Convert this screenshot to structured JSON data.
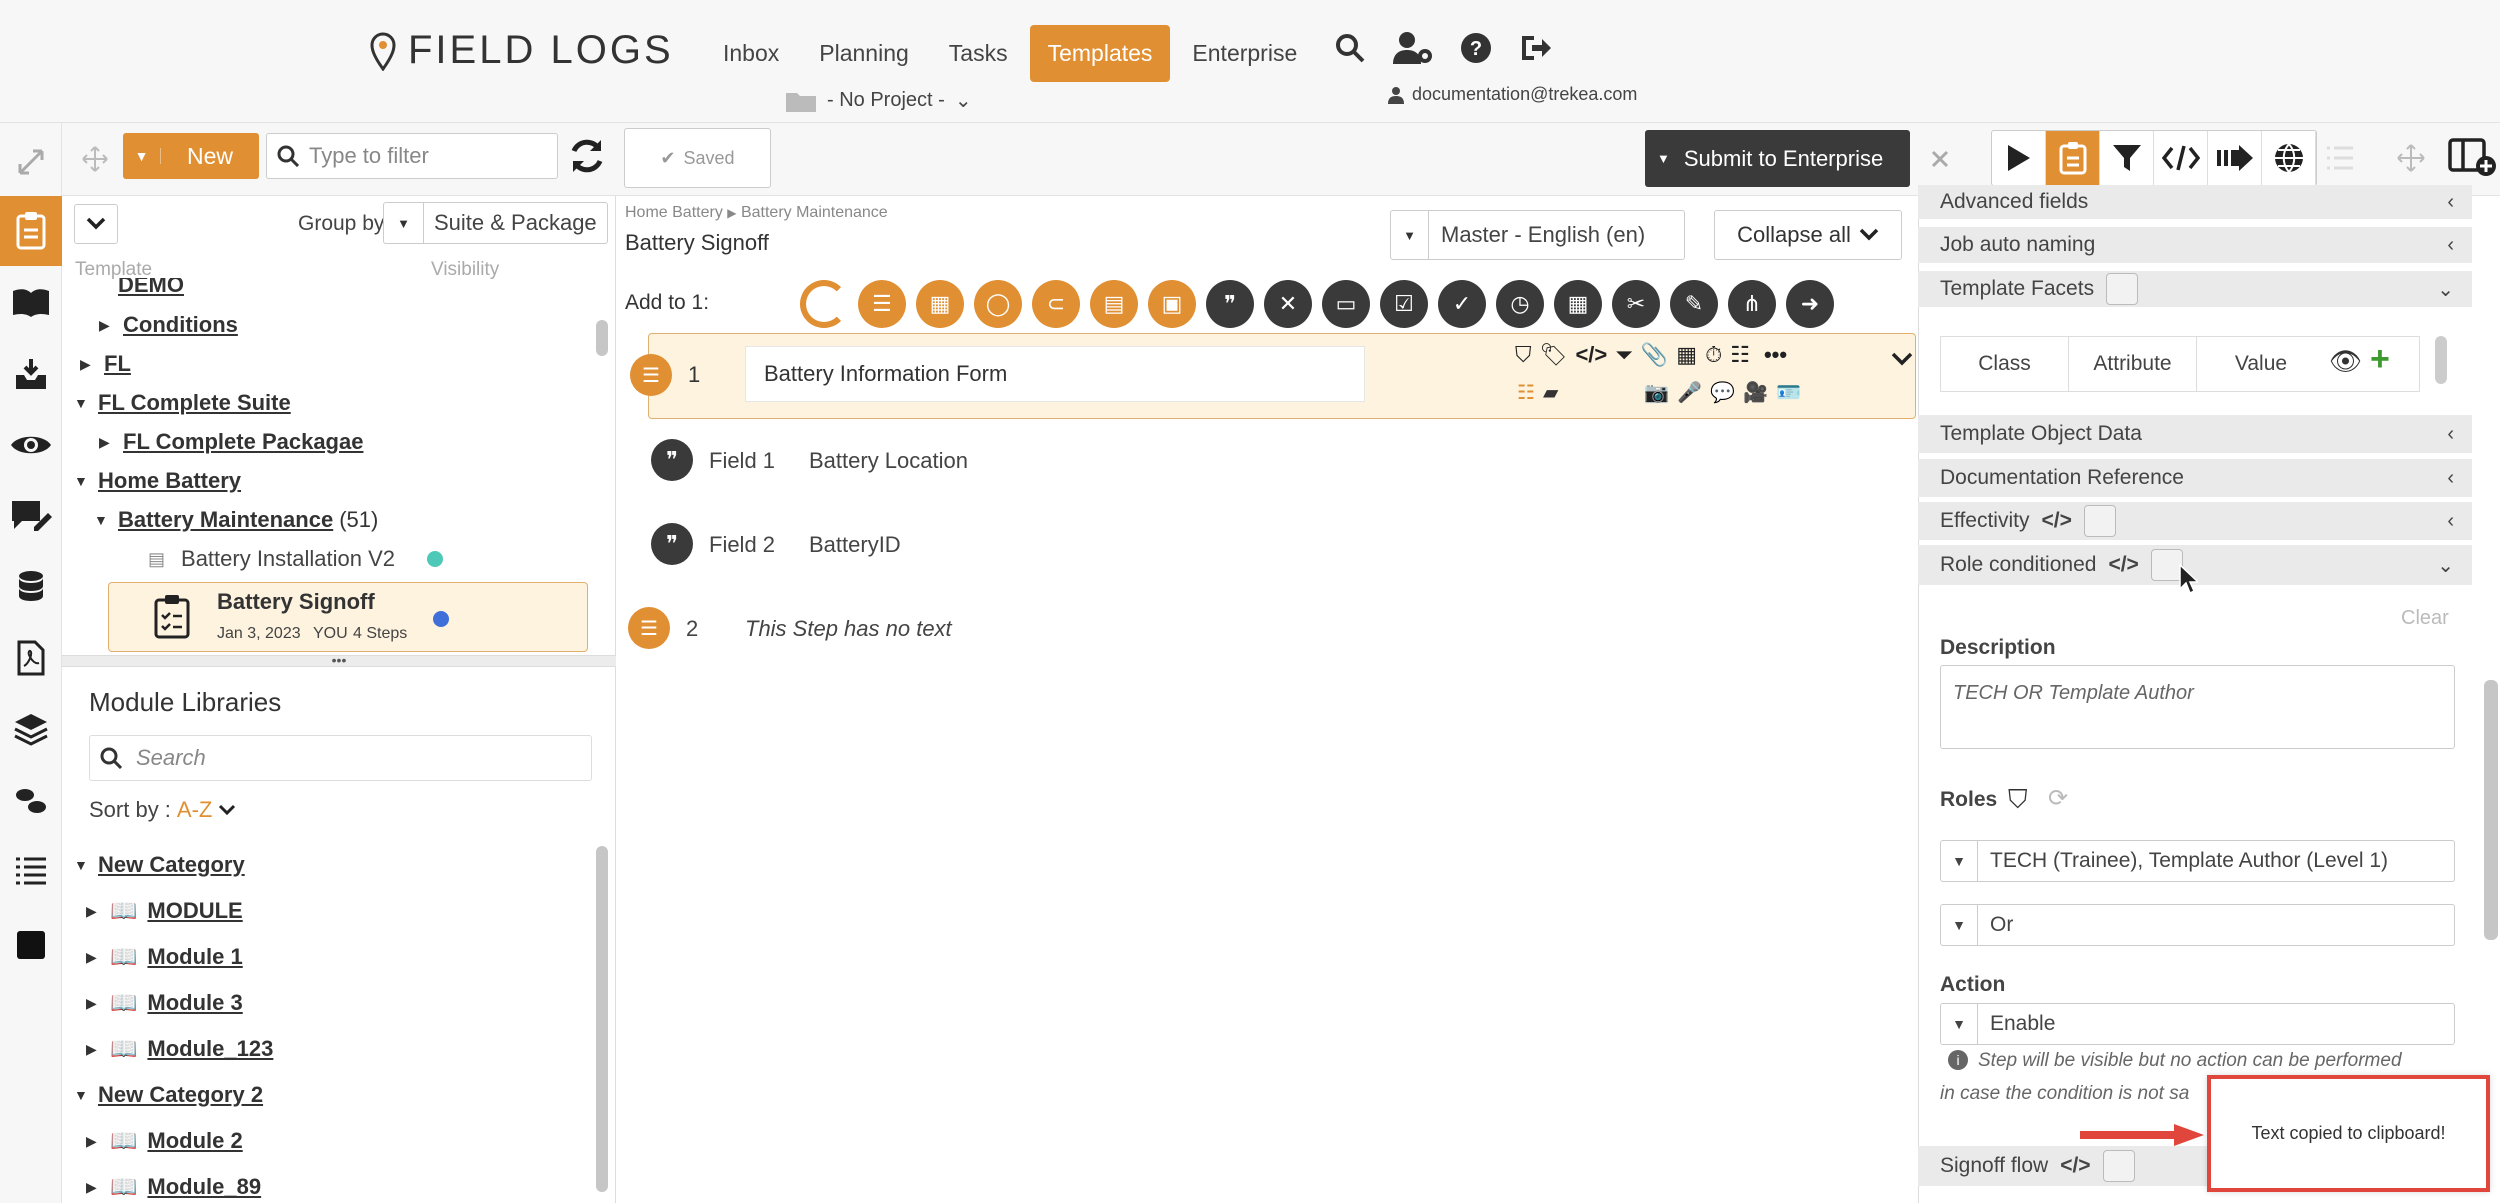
{
  "app": {
    "logo_text": "FIELD LOGS",
    "project": "- No Project -",
    "user": "documentation@trekea.com"
  },
  "nav": [
    {
      "label": "Inbox"
    },
    {
      "label": "Planning"
    },
    {
      "label": "Tasks"
    },
    {
      "label": "Templates"
    },
    {
      "label": "Enterprise"
    }
  ],
  "left": {
    "new_label": "New",
    "filter_placeholder": "Type to filter",
    "group_by_label": "Group by",
    "group_by_value": "Suite & Package",
    "col_template": "Template",
    "col_visibility": "Visibility",
    "tree": [
      {
        "label": "DEMO",
        "cut": true
      },
      {
        "label": "Conditions"
      },
      {
        "label": "FL"
      },
      {
        "label": "FL Complete Suite"
      },
      {
        "label": "FL Complete Packagae"
      },
      {
        "label": "Home Battery"
      },
      {
        "label": "Battery Maintenance",
        "count": "(51)"
      },
      {
        "label": "Battery Installation V2"
      }
    ],
    "selected": {
      "title": "Battery Signoff",
      "date": "Jan 3, 2023",
      "who": "YOU",
      "steps": "4 Steps"
    },
    "modules": {
      "title": "Module Libraries",
      "search_placeholder": "Search",
      "sort_label": "Sort by :",
      "sort_value": "A-Z",
      "items": [
        {
          "label": "New Category",
          "kind": "category"
        },
        {
          "label": "MODULE"
        },
        {
          "label": "Module 1"
        },
        {
          "label": "Module 3"
        },
        {
          "label": "Module_123"
        },
        {
          "label": "New Category 2",
          "kind": "category"
        },
        {
          "label": "Module 2"
        },
        {
          "label": "Module_89"
        }
      ]
    }
  },
  "center": {
    "saved_label": "Saved",
    "breadcrumb": [
      "Home Battery",
      "Battery Maintenance"
    ],
    "title": "Battery Signoff",
    "language": "Master - English (en)",
    "collapse_label": "Collapse all",
    "add_to": "Add to 1:",
    "step1": {
      "num": "1",
      "title": "Battery Information Form"
    },
    "fields": [
      {
        "label": "Field 1",
        "value": "Battery Location"
      },
      {
        "label": "Field 2",
        "value": "BatteryID"
      }
    ],
    "step2": {
      "num": "2",
      "text": "This Step has no text"
    }
  },
  "submit_label": "Submit to Enterprise",
  "right": {
    "rows1": [
      "Advanced fields",
      "Job auto naming",
      "Template Facets"
    ],
    "facet_cols": [
      "Class",
      "Attribute",
      "Value"
    ],
    "rows2": [
      "Template Object Data",
      "Documentation Reference",
      "Effectivity",
      "Role conditioned"
    ],
    "clear": "Clear",
    "description_label": "Description",
    "description_placeholder": "TECH OR Template Author",
    "roles_label": "Roles",
    "roles_value": "TECH (Trainee), Template Author (Level 1)",
    "roles_op": "Or",
    "action_label": "Action",
    "action_value": "Enable",
    "action_note_1": "Step will be visible but no action can be performed",
    "action_note_2": "in case the condition is not sa",
    "signoff_flow": "Signoff flow"
  },
  "toast": "Text copied to clipboard!",
  "colors": {
    "accent": "#e08f32",
    "dark": "#3a3a3a",
    "toast_border": "#e0463b",
    "teal_dot": "#4ec9b8",
    "blue_dot": "#3f6fd8"
  }
}
